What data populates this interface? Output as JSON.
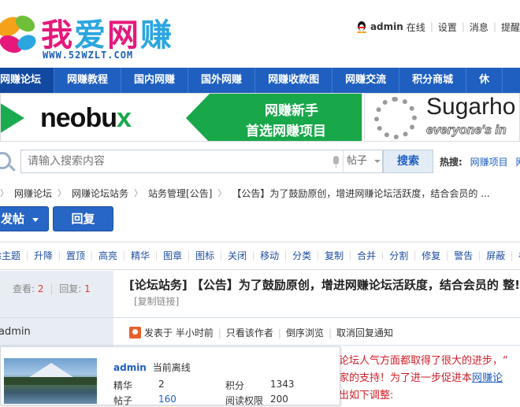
{
  "header": {
    "logo_cn": [
      "我",
      "爱",
      "网",
      "赚"
    ],
    "logo_en": "WWW.52WZLT.COM",
    "user": "admin",
    "status": "在线",
    "links": [
      "设置",
      "消息",
      "提醒"
    ]
  },
  "nav": [
    "网赚论坛",
    "网赚教程",
    "国内网赚",
    "国外网赚",
    "网赚收款图",
    "网赚交流",
    "积分商城",
    "休"
  ],
  "banner1": {
    "brand_main": "neobu",
    "brand_x": "x",
    "line1": "网赚新手",
    "line2": "首选网赚项目"
  },
  "banner2": {
    "title": "Sugarho",
    "tagline": "everyone's in"
  },
  "search": {
    "placeholder": "请输入搜索内容",
    "type": "帖子",
    "button": "搜索",
    "hot_label": "热搜:",
    "hot_links": [
      "网赚项目",
      "网"
    ]
  },
  "breadcrumb": [
    "网赚论坛",
    "网赚论坛站务",
    "站务管理[公告]",
    "【公告】为了鼓励原创，增进网赚论坛活跃度，结合会员的 ..."
  ],
  "buttons": {
    "post": "发帖",
    "reply": "回复"
  },
  "mod_tools": [
    "除主题",
    "升降",
    "置顶",
    "高亮",
    "精华",
    "图章",
    "图标",
    "关闭",
    "移动",
    "分类",
    "复制",
    "合并",
    "分割",
    "修复",
    "警告",
    "屏蔽",
    "标签"
  ],
  "stats": {
    "views_label": "查看:",
    "views": "2",
    "replies_label": "回复:",
    "replies": "1"
  },
  "thread": {
    "title": "[论坛站务] 【公告】为了鼓励原创，增进网赚论坛活跃度，结合会员的 整!",
    "copy_link": "[复制链接]",
    "author": "admin",
    "posted": "发表于 半小时前",
    "only_author": "只看该作者",
    "reverse": "倒序浏览",
    "cancel_notify": "取消回复通知"
  },
  "usercard": {
    "name": "admin",
    "status": "当前离线",
    "fields": [
      {
        "k": "精华",
        "v": "2"
      },
      {
        "k": "积分",
        "v": "1343"
      },
      {
        "k": "帖子",
        "v": "160"
      },
      {
        "k": "阅读权限",
        "v": "200"
      }
    ]
  },
  "post_body": {
    "line1": "论坛人气方面都取得了很大的进步，“",
    "line2_pre": "家的支持！为了进一步促进本",
    "line2_link": "网赚论",
    "line3": "出如下调整:"
  }
}
